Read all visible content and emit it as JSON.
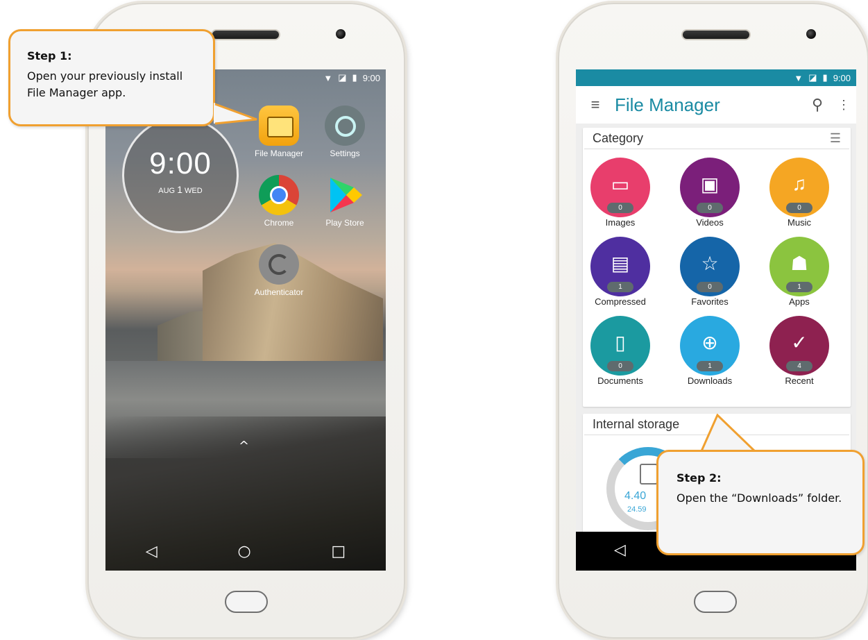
{
  "phone1": {
    "status_time": "9:00",
    "clock": {
      "time": "9:00",
      "date_prefix": "AUG ",
      "date_day": "1",
      "date_suffix": " WED"
    },
    "apps": [
      {
        "label": "File Manager"
      },
      {
        "label": "Settings"
      },
      {
        "label": "Chrome"
      },
      {
        "label": "Play Store"
      },
      {
        "label": "Authenticator"
      }
    ],
    "up_arrow": "^",
    "nav": {
      "back": "◁",
      "home": "○",
      "recents": "□"
    }
  },
  "callout1": {
    "title": "Step 1:",
    "text": "Open your previously install File Manager app."
  },
  "phone2": {
    "status_time": "9:00",
    "header": {
      "title": "File Manager",
      "menu_icon": "≡",
      "search_icon": "⚲",
      "more_icon": "⋮"
    },
    "category": {
      "title": "Category",
      "items": [
        {
          "label": "Images",
          "count": "0",
          "color": "#e83e6c"
        },
        {
          "label": "Videos",
          "count": "0",
          "color": "#7b1f7a"
        },
        {
          "label": "Music",
          "count": "0",
          "color": "#f5a623"
        },
        {
          "label": "Compressed",
          "count": "1",
          "color": "#4f2fa0"
        },
        {
          "label": "Favorites",
          "count": "0",
          "color": "#1565a8"
        },
        {
          "label": "Apps",
          "count": "1",
          "color": "#8bc43f"
        },
        {
          "label": "Documents",
          "count": "0",
          "color": "#1b9aa0"
        },
        {
          "label": "Downloads",
          "count": "1",
          "color": "#29a9e0"
        },
        {
          "label": "Recent",
          "count": "4",
          "color": "#8e2150"
        }
      ]
    },
    "storage": {
      "title": "Internal storage",
      "used": "4.40",
      "total": "24.59"
    },
    "nav": {
      "back": "◁"
    }
  },
  "callout2": {
    "title": "Step 2:",
    "text": "Open the “Downloads” folder."
  },
  "colors": {
    "accent": "#1a8ba3",
    "callout_border": "#f0a030"
  }
}
